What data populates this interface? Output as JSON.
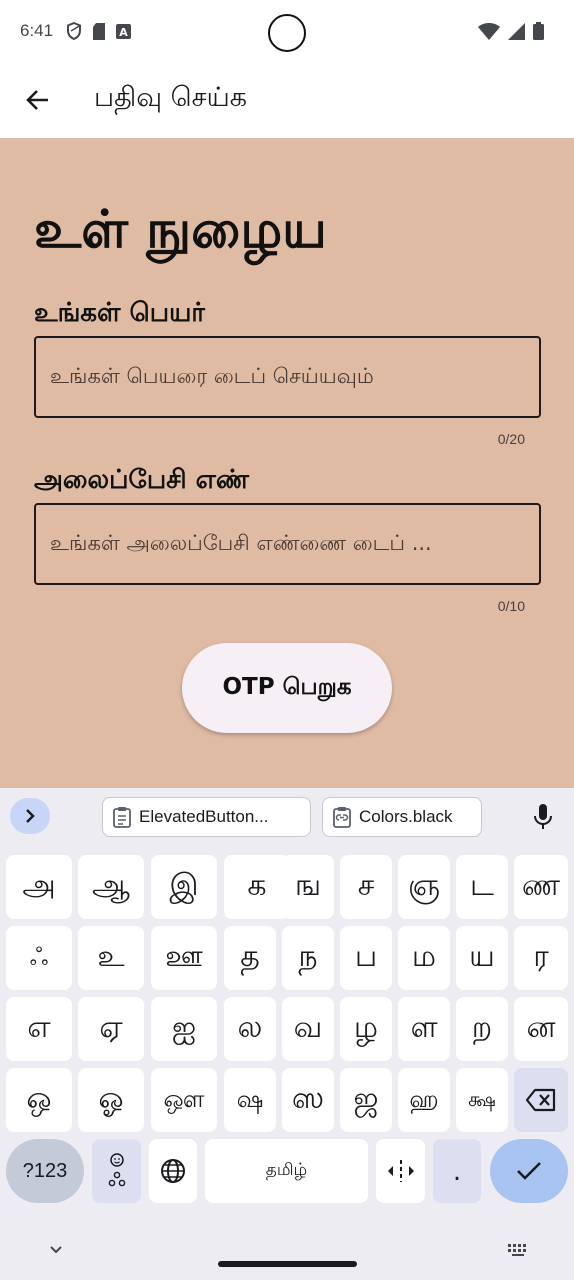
{
  "status_bar": {
    "time": "6:41",
    "left_icons": [
      "shield-icon",
      "sd-card-icon",
      "a-icon"
    ],
    "right_icons": [
      "wifi-icon",
      "signal-icon",
      "battery-icon"
    ]
  },
  "app_bar": {
    "back_icon": "arrow-left-icon",
    "title": "பதிவு செய்க"
  },
  "form": {
    "heading": "உள் நுழைய",
    "name_label": "உங்கள் பெயர்",
    "name_placeholder": "உங்கள் பெயரை டைப் செய்யவும்",
    "name_counter": "0/20",
    "phone_label": "அலைப்பேசி எண்",
    "phone_placeholder": "உங்கள் அலைப்பேசி எண்ணை டைப் ...",
    "phone_counter": "0/10",
    "otp_button": "OTP பெறுக"
  },
  "colors": {
    "content_bg": "#dfbba4",
    "keyboard_bg": "#eeecf3",
    "done_key": "#a8c4f0"
  },
  "keyboard": {
    "suggestions": [
      {
        "icon": "clipboard-icon",
        "text": "ElevatedButton..."
      },
      {
        "icon": "clipboard-link-icon",
        "text": "Colors.black"
      }
    ],
    "row1": [
      "அ",
      "ஆ",
      "இ",
      "க",
      "ங",
      "ச",
      "ஞ",
      "ட",
      "ண"
    ],
    "row2": [
      "ஃ",
      "உ",
      "ஊ",
      "த",
      "ந",
      "ப",
      "ம",
      "ய",
      "ர"
    ],
    "row3": [
      "எ",
      "ஏ",
      "ஐ",
      "ல",
      "வ",
      "ழ",
      "ள",
      "ற",
      "ன"
    ],
    "row4": [
      "ஒ",
      "ஓ",
      "ஔ",
      "ஷ",
      "ஸ",
      "ஜ",
      "ஹ",
      "க்ஷ"
    ],
    "symbols_key": "?123",
    "space_label": "தமிழ்",
    "period_key": "."
  }
}
